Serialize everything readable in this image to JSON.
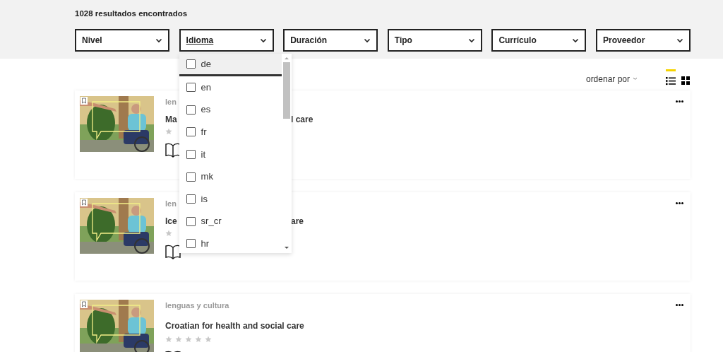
{
  "results_count": "1028 resultados encontrados",
  "filters": [
    {
      "label": "Nivel",
      "open": false
    },
    {
      "label": "Idioma",
      "open": true
    },
    {
      "label": "Duración",
      "open": false
    },
    {
      "label": "Tipo",
      "open": false
    },
    {
      "label": "Currículo",
      "open": false
    },
    {
      "label": "Proveedor",
      "open": false
    }
  ],
  "language_menu": {
    "options": [
      {
        "label": "de",
        "checked": false,
        "highlighted": true
      },
      {
        "label": "en",
        "checked": false,
        "highlighted": false
      },
      {
        "label": "es",
        "checked": false,
        "highlighted": false
      },
      {
        "label": "fr",
        "checked": false,
        "highlighted": false
      },
      {
        "label": "it",
        "checked": false,
        "highlighted": false
      },
      {
        "label": "mk",
        "checked": false,
        "highlighted": false
      },
      {
        "label": "is",
        "checked": false,
        "highlighted": false
      },
      {
        "label": "sr_cr",
        "checked": false,
        "highlighted": false
      },
      {
        "label": "hr",
        "checked": false,
        "highlighted": false
      }
    ]
  },
  "sort": {
    "label": "ordenar por"
  },
  "view_modes": [
    {
      "kind": "list",
      "selected": true
    },
    {
      "kind": "grid",
      "selected": false
    }
  ],
  "courses": [
    {
      "category": "len",
      "title": "Ma",
      "title_end": "l care"
    },
    {
      "category": "len",
      "title": "Ice",
      "title_end": "are"
    },
    {
      "category": "lenguas y cultura",
      "title": "Croatian for health and social care",
      "stars": 0
    }
  ]
}
